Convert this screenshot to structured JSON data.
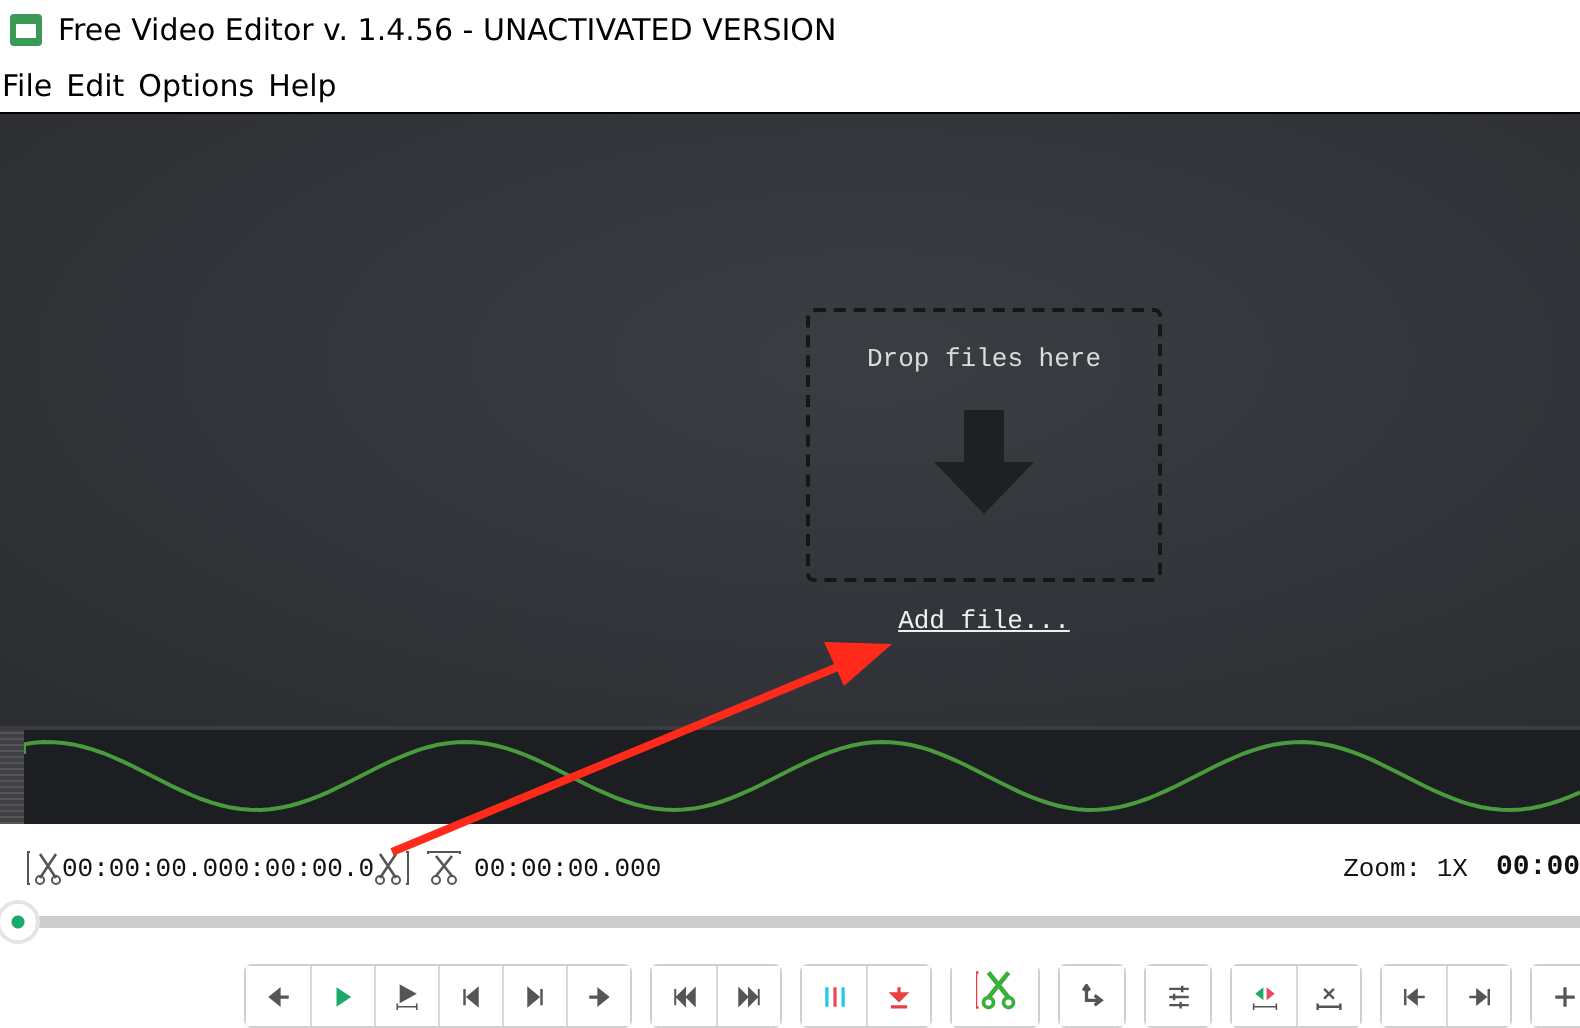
{
  "window": {
    "title": "Free Video Editor v. 1.4.56 - UNACTIVATED VERSION"
  },
  "menu": [
    "File",
    "Edit",
    "Options",
    "Help"
  ],
  "drop_zone": {
    "label": "Drop files here",
    "link": "Add file..."
  },
  "selection": {
    "start": "00:00:00.000",
    "end": ":00:00.0",
    "duration": "00:00:00.000"
  },
  "zoom": "Zoom: 1X",
  "position": "00:00",
  "timeline": {
    "level": 0
  }
}
